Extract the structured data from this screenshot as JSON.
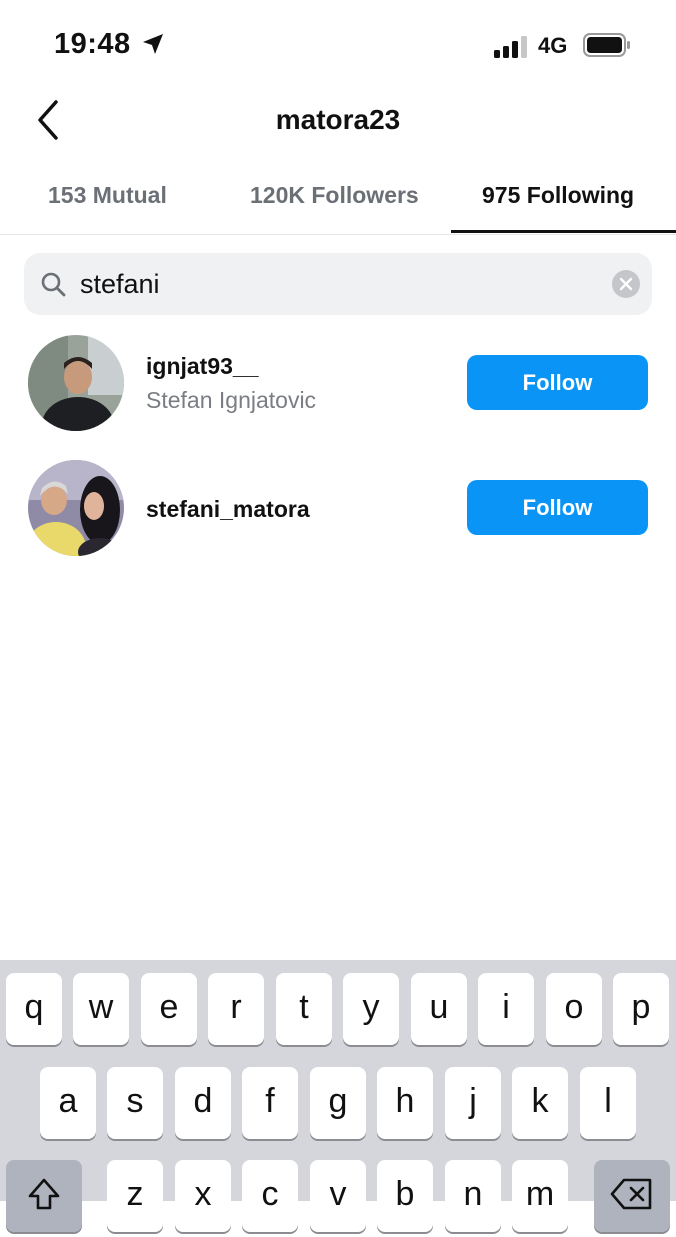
{
  "status_bar": {
    "time": "19:48",
    "network": "4G"
  },
  "header": {
    "title": "matora23"
  },
  "tabs": [
    {
      "label": "153 Mutual"
    },
    {
      "label": "120K Followers"
    },
    {
      "label": "975 Following"
    }
  ],
  "search": {
    "value": "stefani"
  },
  "results": [
    {
      "username": "ignjat93__",
      "full_name": "Stefan Ignjatovic",
      "button": "Follow"
    },
    {
      "username": "stefani_matora",
      "full_name": "",
      "button": "Follow"
    }
  ],
  "keyboard": {
    "row1": [
      "q",
      "w",
      "e",
      "r",
      "t",
      "y",
      "u",
      "i",
      "o",
      "p"
    ],
    "row2": [
      "a",
      "s",
      "d",
      "f",
      "g",
      "h",
      "j",
      "k",
      "l"
    ],
    "row3": [
      "z",
      "x",
      "c",
      "v",
      "b",
      "n",
      "m"
    ]
  },
  "colors": {
    "accent": "#0a95f6",
    "tab_inactive": "#6b6f76",
    "keyboard_bg": "#d4d6db"
  }
}
